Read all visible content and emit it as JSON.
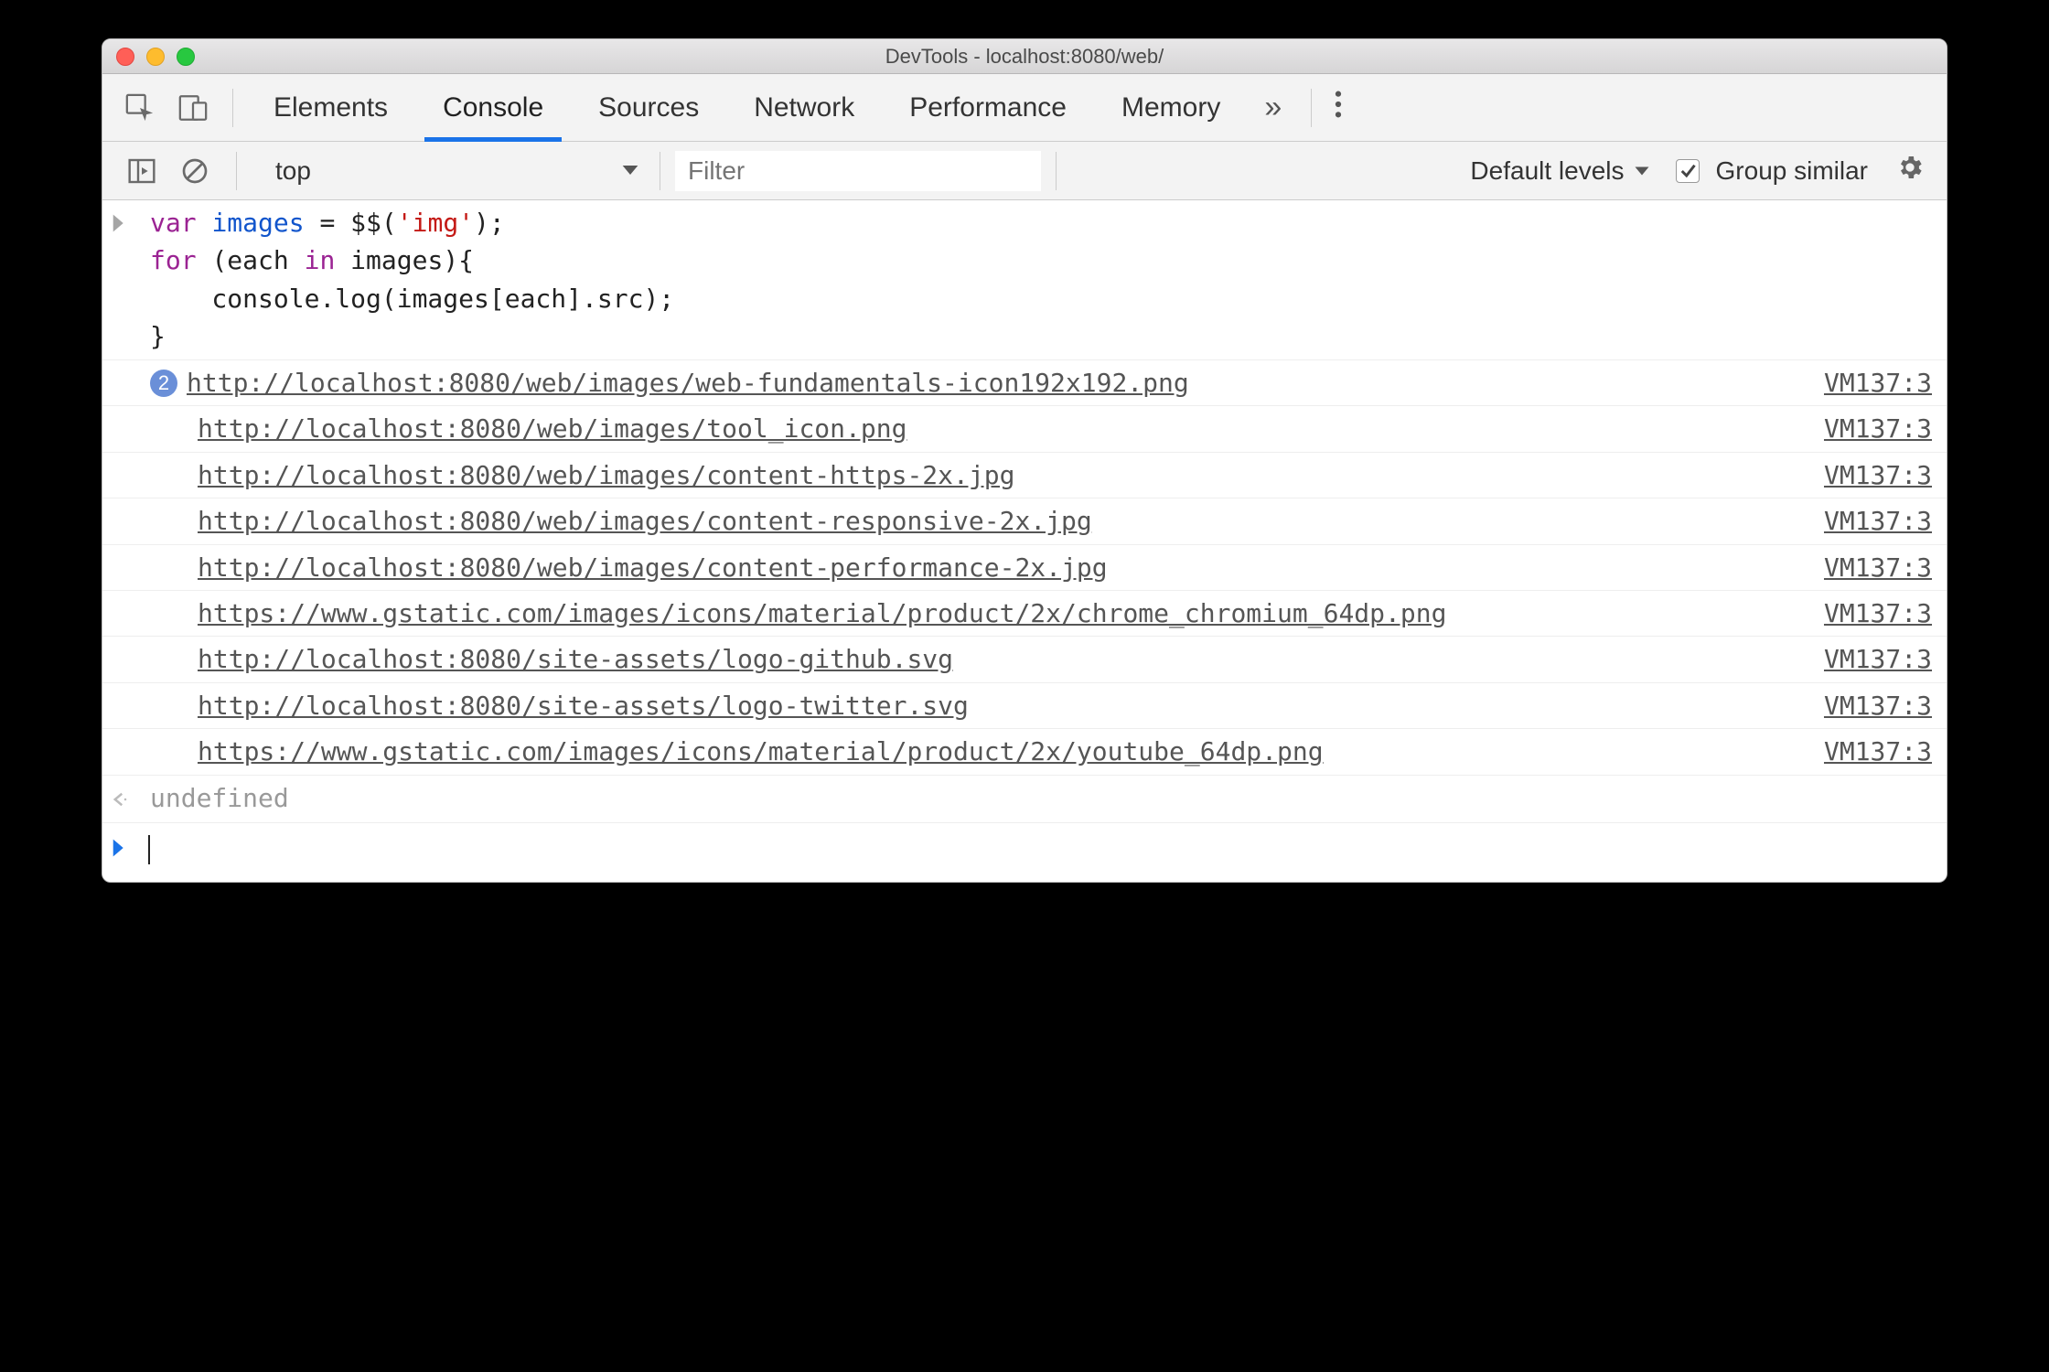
{
  "window_title": "DevTools - localhost:8080/web/",
  "tabs": {
    "elements": "Elements",
    "console": "Console",
    "sources": "Sources",
    "network": "Network",
    "performance": "Performance",
    "memory": "Memory"
  },
  "filterbar": {
    "context": "top",
    "filter_placeholder": "Filter",
    "levels_label": "Default levels",
    "group_similar_label": "Group similar",
    "group_similar_checked": true
  },
  "code_lines": [
    "var images = $$('img');",
    "for (each in images){",
    "    console.log(images[each].src);",
    "}"
  ],
  "console_entries": [
    {
      "badge": "2",
      "url": "http://localhost:8080/web/images/web-fundamentals-icon192x192.png",
      "source": "VM137:3"
    },
    {
      "url": "http://localhost:8080/web/images/tool_icon.png",
      "source": "VM137:3"
    },
    {
      "url": "http://localhost:8080/web/images/content-https-2x.jpg",
      "source": "VM137:3"
    },
    {
      "url": "http://localhost:8080/web/images/content-responsive-2x.jpg",
      "source": "VM137:3"
    },
    {
      "url": "http://localhost:8080/web/images/content-performance-2x.jpg",
      "source": "VM137:3"
    },
    {
      "url": "https://www.gstatic.com/images/icons/material/product/2x/chrome_chromium_64dp.png",
      "source": "VM137:3"
    },
    {
      "url": "http://localhost:8080/site-assets/logo-github.svg",
      "source": "VM137:3"
    },
    {
      "url": "http://localhost:8080/site-assets/logo-twitter.svg",
      "source": "VM137:3"
    },
    {
      "url": "https://www.gstatic.com/images/icons/material/product/2x/youtube_64dp.png",
      "source": "VM137:3"
    }
  ],
  "return_value": "undefined"
}
